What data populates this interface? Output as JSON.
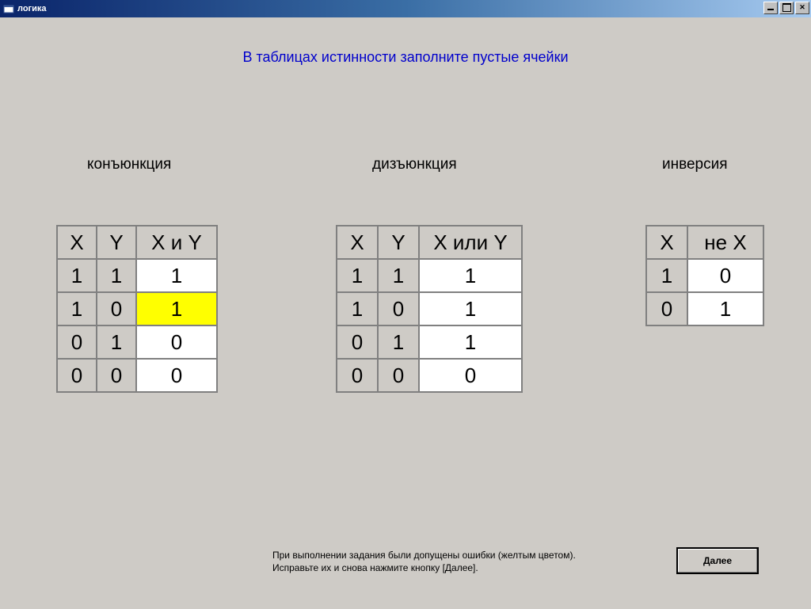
{
  "window": {
    "title": "логика"
  },
  "instruction": "В таблицах истинности заполните пустые ячейки",
  "tables": {
    "conjunction": {
      "label": "конъюнкция",
      "headers": [
        "X",
        "Y",
        "X и Y"
      ],
      "rows": [
        {
          "x": "1",
          "y": "1",
          "r": "1",
          "err": false
        },
        {
          "x": "1",
          "y": "0",
          "r": "1",
          "err": true
        },
        {
          "x": "0",
          "y": "1",
          "r": "0",
          "err": false
        },
        {
          "x": "0",
          "y": "0",
          "r": "0",
          "err": false
        }
      ]
    },
    "disjunction": {
      "label": "дизъюнкция",
      "headers": [
        "X",
        "Y",
        "X или Y"
      ],
      "rows": [
        {
          "x": "1",
          "y": "1",
          "r": "1",
          "err": false
        },
        {
          "x": "1",
          "y": "0",
          "r": "1",
          "err": false
        },
        {
          "x": "0",
          "y": "1",
          "r": "1",
          "err": false
        },
        {
          "x": "0",
          "y": "0",
          "r": "0",
          "err": false
        }
      ]
    },
    "inversion": {
      "label": "инверсия",
      "headers": [
        "X",
        "не X"
      ],
      "rows": [
        {
          "x": "1",
          "r": "0",
          "err": false
        },
        {
          "x": "0",
          "r": "1",
          "err": false
        }
      ]
    }
  },
  "hint": {
    "line1": "При выполнении задания были допущены ошибки (желтым цветом).",
    "line2": "Исправьте их и снова нажмите кнопку  [Далее]."
  },
  "buttons": {
    "next": "Далее"
  }
}
